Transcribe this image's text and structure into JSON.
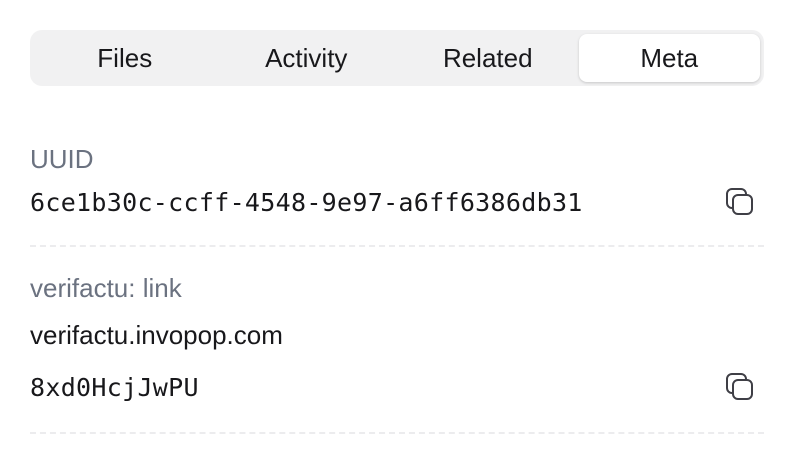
{
  "tabs": [
    {
      "label": "Files",
      "active": false
    },
    {
      "label": "Activity",
      "active": false
    },
    {
      "label": "Related",
      "active": false
    },
    {
      "label": "Meta",
      "active": true
    }
  ],
  "uuid": {
    "label": "UUID",
    "value": "6ce1b30c-ccff-4548-9e97-a6ff6386db31",
    "copy_icon": "copy-icon"
  },
  "verifactu": {
    "label": "verifactu: link",
    "host": "verifactu.invopop.com",
    "code": "8xd0HcjJwPU",
    "copy_icon": "copy-icon"
  },
  "colors": {
    "tab_bar_bg": "#f1f1f2",
    "label": "#6b7280",
    "text": "#18181b",
    "divider": "#ececee"
  }
}
